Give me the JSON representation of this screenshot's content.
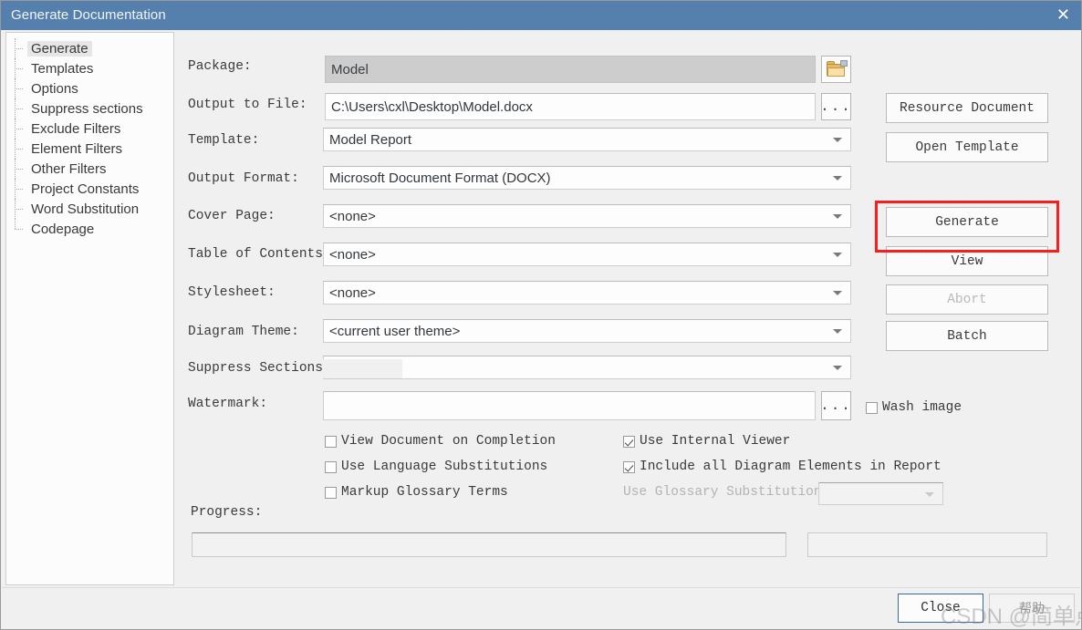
{
  "window": {
    "title": "Generate Documentation",
    "close_icon": "close-x-icon"
  },
  "sidebar": {
    "items": [
      {
        "label": "Generate",
        "selected": true
      },
      {
        "label": "Templates",
        "selected": false
      },
      {
        "label": "Options",
        "selected": false
      },
      {
        "label": "Suppress sections",
        "selected": false
      },
      {
        "label": "Exclude Filters",
        "selected": false
      },
      {
        "label": "Element Filters",
        "selected": false
      },
      {
        "label": "Other Filters",
        "selected": false
      },
      {
        "label": "Project Constants",
        "selected": false
      },
      {
        "label": "Word Substitution",
        "selected": false
      },
      {
        "label": "Codepage",
        "selected": false
      }
    ]
  },
  "form": {
    "package": {
      "label": "Package:",
      "value": "Model",
      "disabled": true
    },
    "browse_package_icon": "folder-icon",
    "output_to_file": {
      "label": "Output to File:",
      "value": "C:\\Users\\cxl\\Desktop\\Model.docx"
    },
    "output_browse_label": "...",
    "template": {
      "label": "Template:",
      "value": "Model Report"
    },
    "output_format": {
      "label": "Output Format:",
      "value": "Microsoft Document Format (DOCX)"
    },
    "cover_page": {
      "label": "Cover Page:",
      "value": "<none>"
    },
    "table_of_contents": {
      "label": "Table of Contents:",
      "value": "<none>"
    },
    "stylesheet": {
      "label": "Stylesheet:",
      "value": "<none>"
    },
    "diagram_theme": {
      "label": "Diagram Theme:",
      "value": "<current user theme>"
    },
    "suppress_sections": {
      "label": "Suppress Sections",
      "value": ""
    },
    "watermark": {
      "label": "Watermark:",
      "value": ""
    },
    "watermark_browse_label": "...",
    "progress": {
      "label": "Progress:"
    }
  },
  "checkboxes": {
    "view_document_on_completion": {
      "label": "View Document on Completion",
      "checked": false,
      "disabled": false
    },
    "use_language_substitutions": {
      "label": "Use Language Substitutions",
      "checked": false,
      "disabled": false
    },
    "markup_glossary_terms": {
      "label": "Markup Glossary Terms",
      "checked": false,
      "disabled": false
    },
    "use_internal_viewer": {
      "label": "Use Internal Viewer",
      "checked": true,
      "disabled": false
    },
    "include_all_diagram_elements": {
      "label": "Include all Diagram Elements in Report",
      "checked": true,
      "disabled": false
    },
    "wash_image": {
      "label": "Wash image",
      "checked": false,
      "disabled": false
    },
    "use_glossary_substitution": {
      "label": "Use Glossary Substitution",
      "checked": false,
      "disabled": true,
      "value": ""
    }
  },
  "buttons": {
    "resource_document": {
      "label": "Resource Document",
      "disabled": false
    },
    "open_template": {
      "label": "Open Template",
      "disabled": false
    },
    "generate": {
      "label": "Generate",
      "disabled": false,
      "highlighted": true
    },
    "view": {
      "label": "View",
      "disabled": false
    },
    "abort": {
      "label": "Abort",
      "disabled": true
    },
    "batch": {
      "label": "Batch",
      "disabled": false
    },
    "close": {
      "label": "Close"
    },
    "help": {
      "label": "帮助"
    }
  },
  "annotation": {
    "highlight_color": "#fb1c1c"
  },
  "watermark_overlay": {
    "text": "CSDN @简单点了"
  }
}
